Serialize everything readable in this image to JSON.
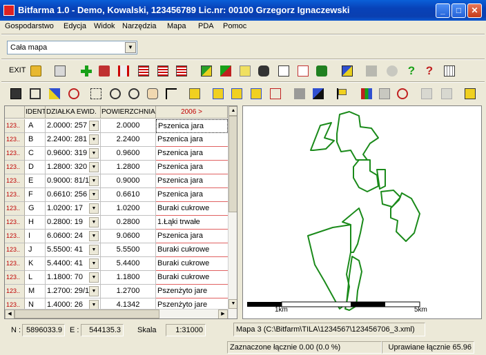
{
  "window": {
    "title": "Bitfarma 1.0 - Demo,  Kowalski, 123456789 Lic.nr: 00100 Grzegorz Ignaczewski",
    "minimize": "_",
    "maximize": "□",
    "close": "✕"
  },
  "menu": [
    "Gospodarstwo",
    "Edycja",
    "Widok",
    "Narzędzia",
    "Mapa",
    "PDA",
    "Pomoc"
  ],
  "map_selector": {
    "value": "Cała mapa",
    "arrow": "▼"
  },
  "toolbar1": {
    "exit_label": "EXIT"
  },
  "grid": {
    "headers": {
      "id": "IDENT",
      "dzialka": "DZIAŁKA EWID.",
      "powierzchnia": "POWIERZCHNIA",
      "year": "2006 >"
    },
    "rows": [
      {
        "rowhdr": "123..",
        "ident": "A",
        "dzialka": "2.0000:  257",
        "pow": "2.0000",
        "crop": "Pszenica jara"
      },
      {
        "rowhdr": "123..",
        "ident": "B",
        "dzialka": "2.2400:  281",
        "pow": "2.2400",
        "crop": "Pszenica jara"
      },
      {
        "rowhdr": "123..",
        "ident": "C",
        "dzialka": "0.9600:  319",
        "pow": "0.9600",
        "crop": "Pszenica jara"
      },
      {
        "rowhdr": "123..",
        "ident": "D",
        "dzialka": "1.2800:  320",
        "pow": "1.2800",
        "crop": "Pszenica jara"
      },
      {
        "rowhdr": "123..",
        "ident": "E",
        "dzialka": "0.9000: 81/1",
        "pow": "0.9000",
        "crop": "Pszenica jara"
      },
      {
        "rowhdr": "123..",
        "ident": "F",
        "dzialka": "0.6610:  256",
        "pow": "0.6610",
        "crop": "Pszenica jara"
      },
      {
        "rowhdr": "123..",
        "ident": "G",
        "dzialka": "1.0200:   17",
        "pow": "1.0200",
        "crop": "Buraki cukrowe"
      },
      {
        "rowhdr": "123..",
        "ident": "H",
        "dzialka": "0.2800:   19",
        "pow": "0.2800",
        "crop": "1.Łąki trwałe"
      },
      {
        "rowhdr": "123..",
        "ident": "I",
        "dzialka": "6.0600:   24",
        "pow": "9.0600",
        "crop": "Pszenica jara"
      },
      {
        "rowhdr": "123..",
        "ident": "J",
        "dzialka": "5.5500:   41",
        "pow": "5.5500",
        "crop": "Buraki cukrowe"
      },
      {
        "rowhdr": "123..",
        "ident": "K",
        "dzialka": "5.4400:   41",
        "pow": "5.4400",
        "crop": "Buraki cukrowe"
      },
      {
        "rowhdr": "123..",
        "ident": "L",
        "dzialka": "1.1800:   70",
        "pow": "1.1800",
        "crop": "Buraki cukrowe"
      },
      {
        "rowhdr": "123..",
        "ident": "M",
        "dzialka": "1.2700: 29/1",
        "pow": "1.2700",
        "crop": "Pszenżyto jare"
      },
      {
        "rowhdr": "123..",
        "ident": "N",
        "dzialka": "1.4000:   26",
        "pow": "4.1342",
        "crop": "Pszenżyto jare"
      }
    ]
  },
  "map": {
    "scale_left": "1km",
    "scale_right": "5km",
    "field_color": "#1a8a1a"
  },
  "status": {
    "n_label": "N :",
    "n_value": "5896033.9",
    "e_label": "E :",
    "e_value": "544135.3",
    "skala_label": "Skala",
    "skala_value": "1:31000",
    "map_file": "Mapa 3 (C:\\Bitfarm\\TILA\\1234567\\123456706_3.xml)",
    "selected": "Zaznaczone łącznie 0.00 (0.0 %)",
    "cultivated": "Uprawiane łącznie 65.96"
  }
}
